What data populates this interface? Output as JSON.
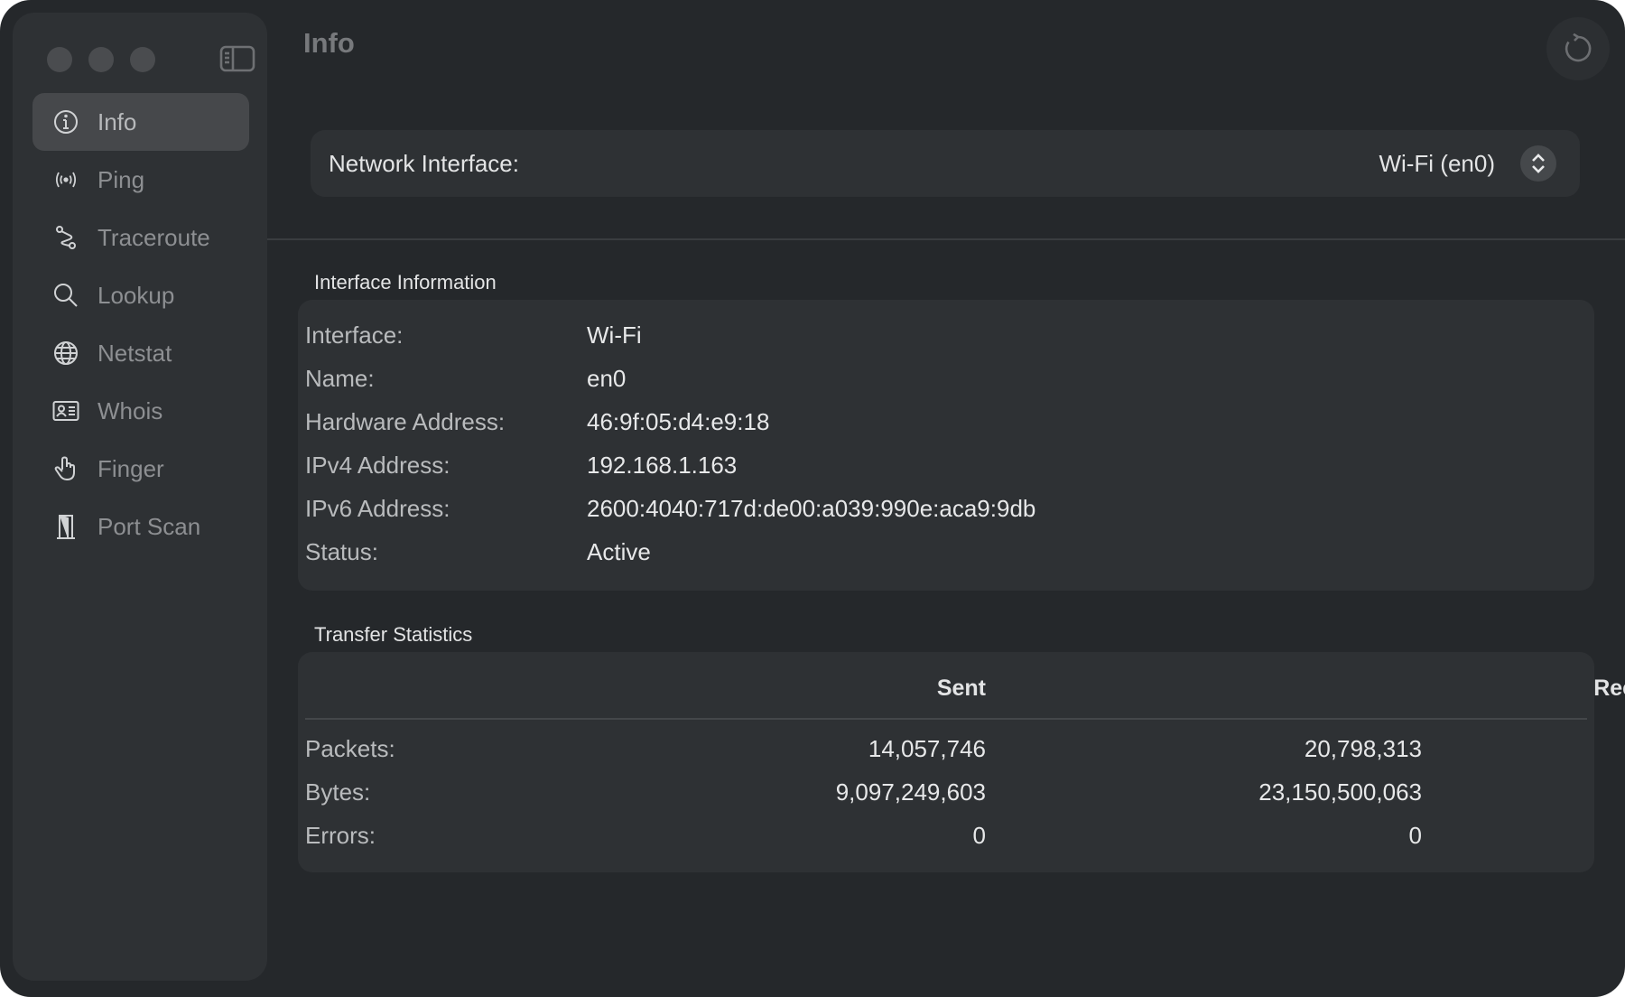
{
  "window": {
    "title": "Info",
    "refresh_icon": "refresh-icon",
    "sidebar_toggle_icon": "sidebar-toggle-icon"
  },
  "sidebar": {
    "items": [
      {
        "label": "Info",
        "icon": "info-icon",
        "active": true
      },
      {
        "label": "Ping",
        "icon": "broadcast-icon",
        "active": false
      },
      {
        "label": "Traceroute",
        "icon": "route-icon",
        "active": false
      },
      {
        "label": "Lookup",
        "icon": "search-icon",
        "active": false
      },
      {
        "label": "Netstat",
        "icon": "globe-icon",
        "active": false
      },
      {
        "label": "Whois",
        "icon": "id-card-icon",
        "active": false
      },
      {
        "label": "Finger",
        "icon": "hand-pointer-icon",
        "active": false
      },
      {
        "label": "Port Scan",
        "icon": "door-icon",
        "active": false
      }
    ]
  },
  "network_interface": {
    "label": "Network Interface:",
    "value": "Wi-Fi (en0)"
  },
  "interface_information": {
    "title": "Interface Information",
    "rows": [
      {
        "label": "Interface:",
        "value": "Wi-Fi"
      },
      {
        "label": "Name:",
        "value": "en0"
      },
      {
        "label": "Hardware Address:",
        "value": "46:9f:05:d4:e9:18"
      },
      {
        "label": "IPv4 Address:",
        "value": "192.168.1.163"
      },
      {
        "label": "IPv6 Address:",
        "value": "2600:4040:717d:de00:a039:990e:aca9:9db"
      },
      {
        "label": "Status:",
        "value": "Active"
      }
    ]
  },
  "transfer_statistics": {
    "title": "Transfer Statistics",
    "columns": [
      "Sent",
      "Received"
    ],
    "rows": [
      {
        "label": "Packets:",
        "sent": "14,057,746",
        "received": "20,798,313"
      },
      {
        "label": "Bytes:",
        "sent": "9,097,249,603",
        "received": "23,150,500,063"
      },
      {
        "label": "Errors:",
        "sent": "0",
        "received": "0"
      }
    ]
  },
  "colors": {
    "window_bg": "#25282b",
    "sidebar_bg": "#2e3134",
    "card_bg": "#2e3134",
    "active_item_bg": "#46484b"
  }
}
